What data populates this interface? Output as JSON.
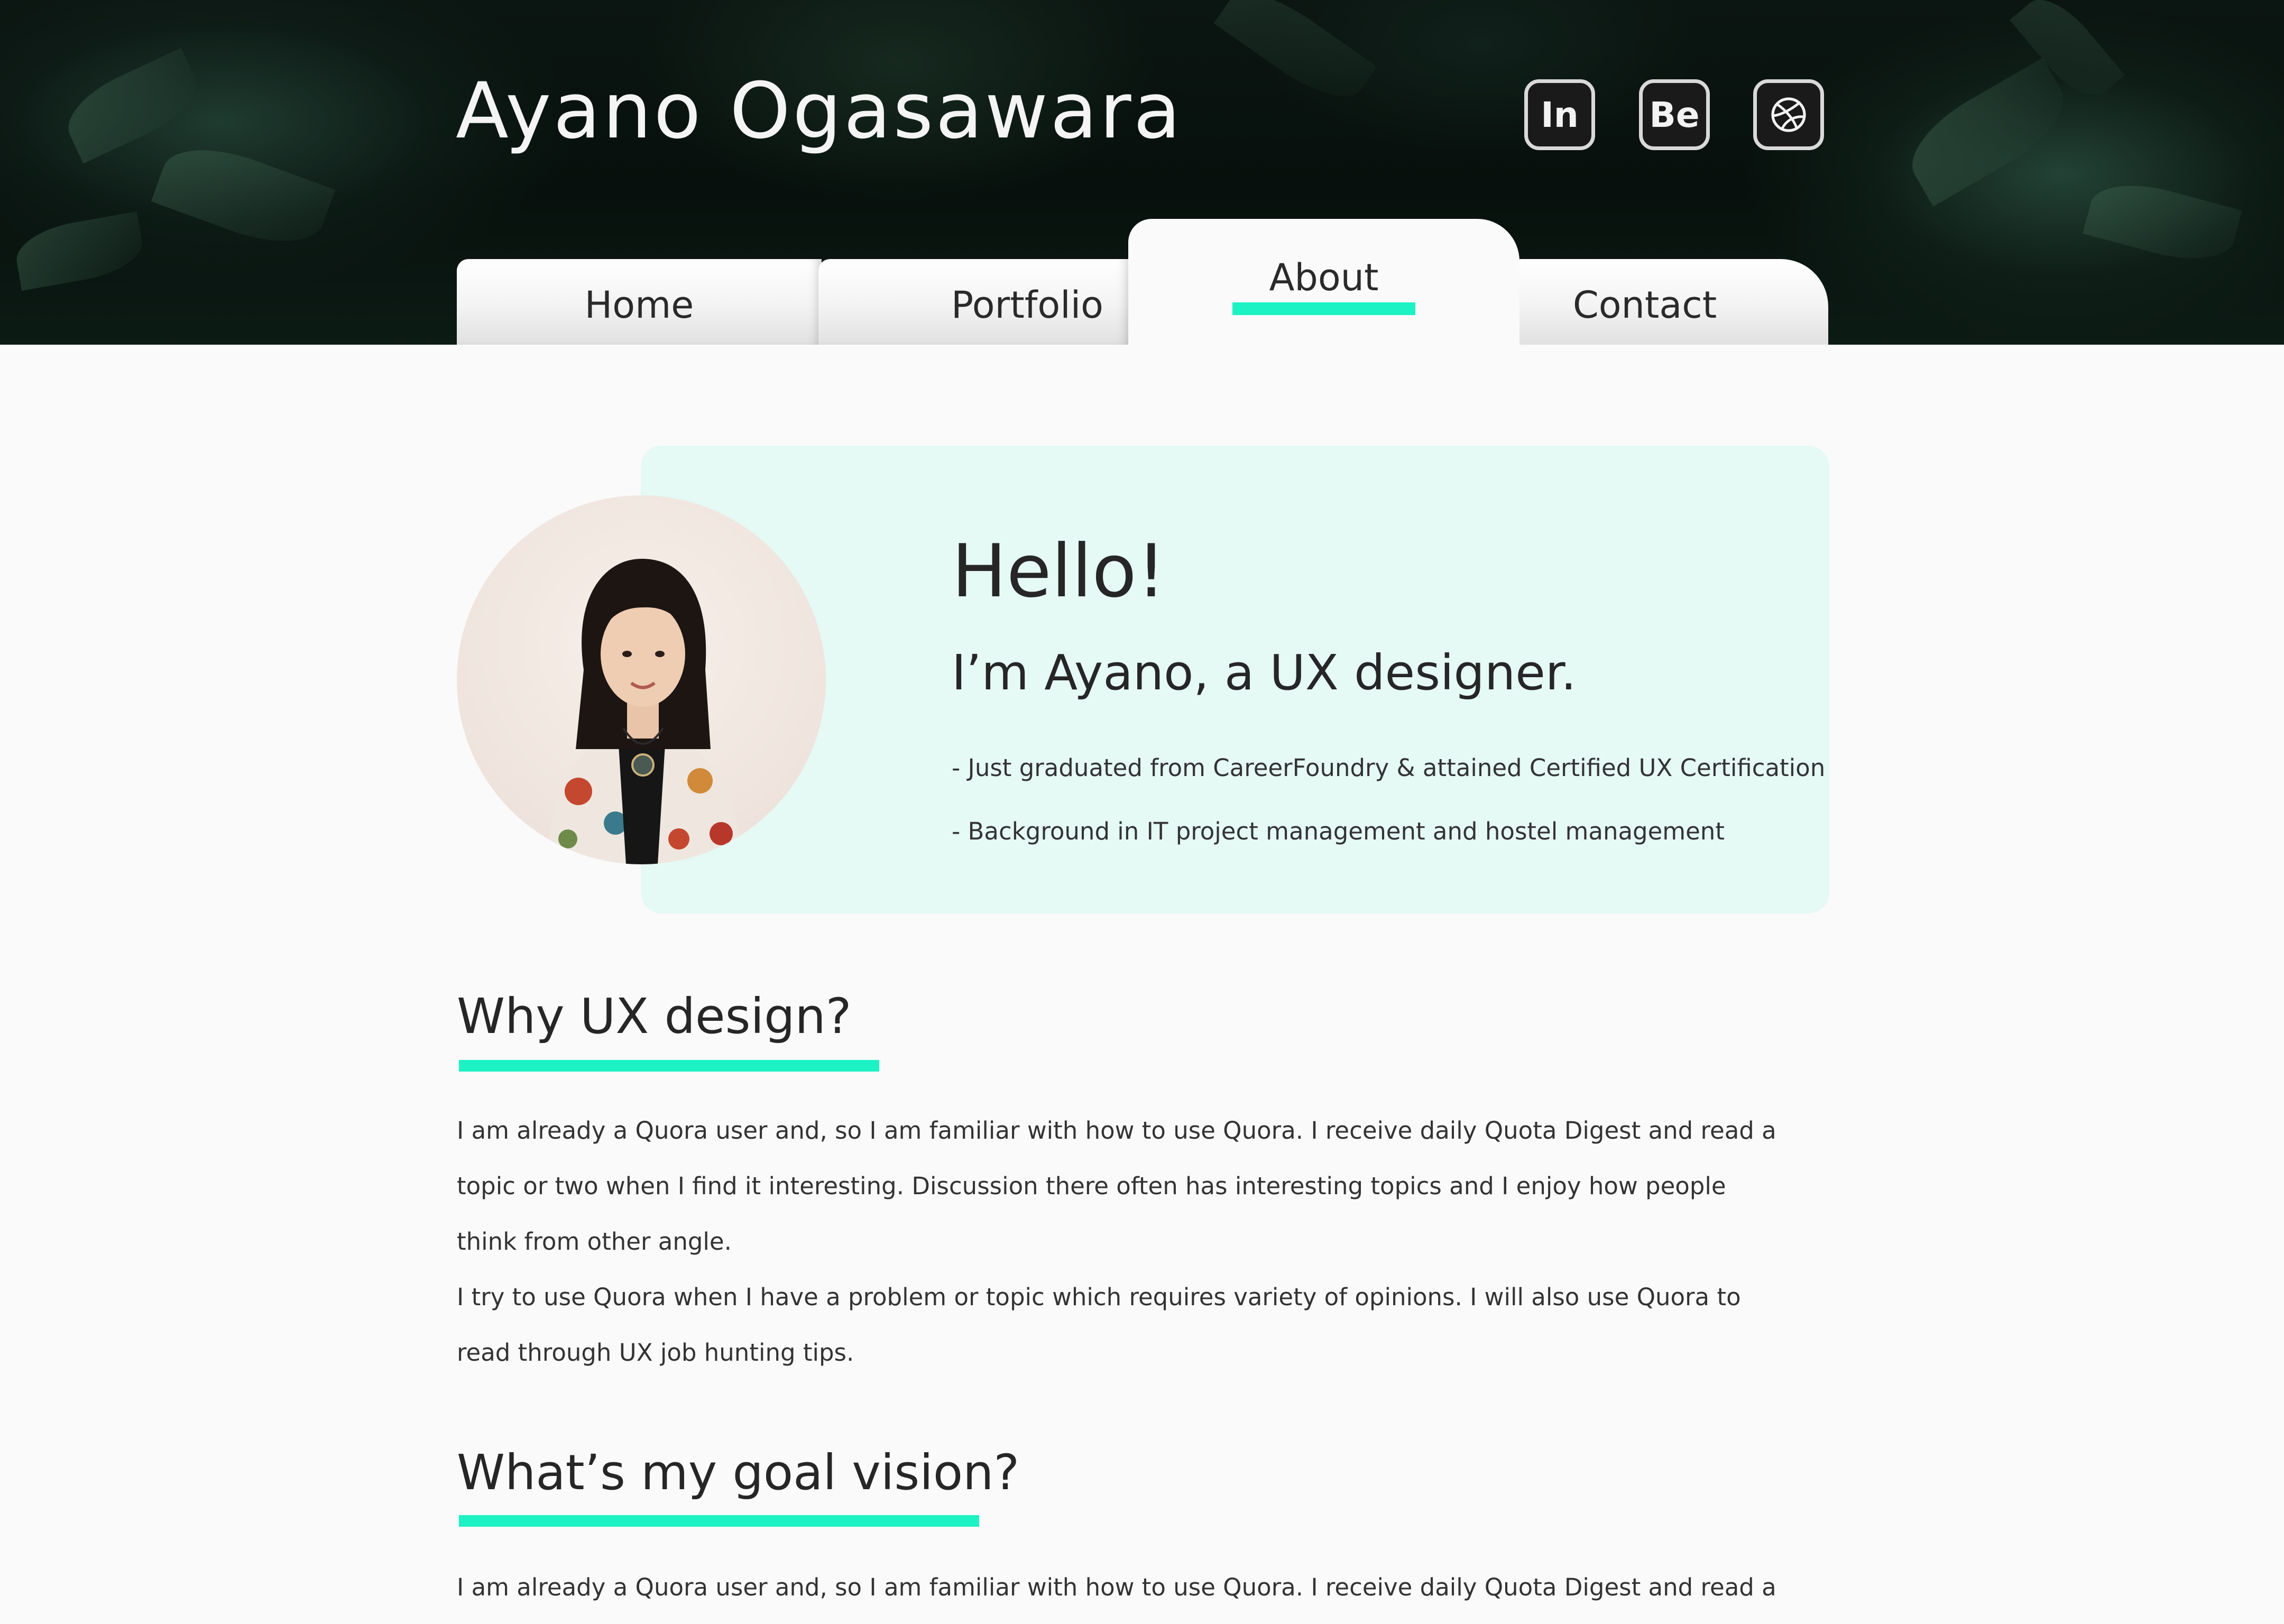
{
  "header": {
    "site_title": "Ayano Ogasawara",
    "social": [
      {
        "label": "In",
        "icon": "invision-icon"
      },
      {
        "label": "Be",
        "icon": "behance-icon"
      },
      {
        "label": "",
        "icon": "dribbble-icon"
      }
    ]
  },
  "nav": {
    "tabs": [
      {
        "label": "Home",
        "active": false
      },
      {
        "label": "Portfolio",
        "active": false
      },
      {
        "label": "About",
        "active": true
      },
      {
        "label": "Contact",
        "active": false
      }
    ]
  },
  "intro": {
    "greeting": "Hello!",
    "headline": "I’m Ayano, a UX designer.",
    "bullets": [
      "- Just graduated from CareerFoundry & attained Certified UX Certification",
      "- Background in IT project management and hostel management"
    ]
  },
  "sections": [
    {
      "heading": "Why UX design?",
      "lines": [
        "I am already a Quora user and, so I am familiar with how to use Quora. I receive daily Quota Digest and read a",
        "topic or two when I find it interesting. Discussion there often has interesting topics and I enjoy how people",
        "think from other angle.",
        "I try to use Quora when I have a problem or topic which requires variety of opinions. I will also use Quora to",
        "read through UX job hunting tips."
      ]
    },
    {
      "heading": "What’s my goal vision?",
      "lines": [
        "I am already a Quora user and, so I am familiar with how to use Quora. I receive daily Quota Digest and read a"
      ]
    }
  ],
  "colors": {
    "accent": "#1cf2c4",
    "card_background": "#e5f9f5",
    "page_background": "#fafafa",
    "text": "#262626"
  }
}
